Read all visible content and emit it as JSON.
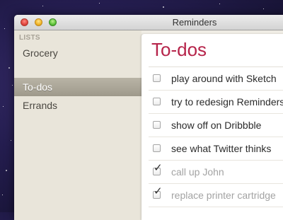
{
  "window": {
    "title": "Reminders"
  },
  "sidebar": {
    "heading": "LISTS",
    "items": [
      {
        "label": "Grocery",
        "selected": false
      },
      {
        "label": "To-dos",
        "selected": true
      },
      {
        "label": "Errands",
        "selected": false
      }
    ]
  },
  "main": {
    "title": "To-dos",
    "tasks": [
      {
        "label": "play around with Sketch",
        "checked": false
      },
      {
        "label": "try to redesign Reminders",
        "checked": false
      },
      {
        "label": "show off on Dribbble",
        "checked": false
      },
      {
        "label": "see what Twitter thinks",
        "checked": false
      },
      {
        "label": "call up John",
        "checked": true
      },
      {
        "label": "replace printer cartridge",
        "checked": true
      }
    ]
  },
  "colors": {
    "accent_title": "#b6244a",
    "selection": "#a7a293"
  },
  "icons": {
    "check": "checkmark-icon"
  }
}
